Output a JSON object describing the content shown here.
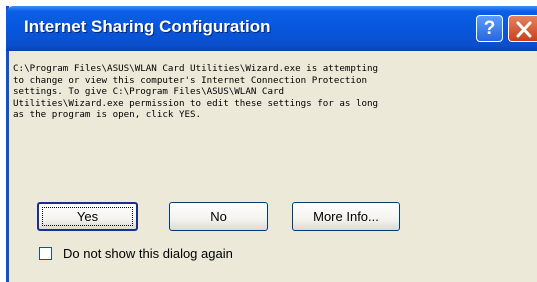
{
  "window": {
    "title": "Internet Sharing Configuration",
    "help_label": "?",
    "close_icon": "close-icon"
  },
  "message": {
    "lines": [
      "C:\\Program Files\\ASUS\\WLAN Card Utilities\\Wizard.exe is attempting",
      "to change or view this computer's Internet Connection Protection",
      "settings. To give C:\\Program Files\\ASUS\\WLAN Card",
      "Utilities\\Wizard.exe permission to edit these settings for as long",
      "as the program is open, click YES."
    ]
  },
  "buttons": {
    "yes": "Yes",
    "no": "No",
    "more_info": "More Info..."
  },
  "checkbox": {
    "label": "Do not show this dialog again",
    "checked": false
  },
  "colors": {
    "title_bar": "#0756dc",
    "dialog_face": "#ece9d8",
    "close_button": "#c8411c"
  }
}
